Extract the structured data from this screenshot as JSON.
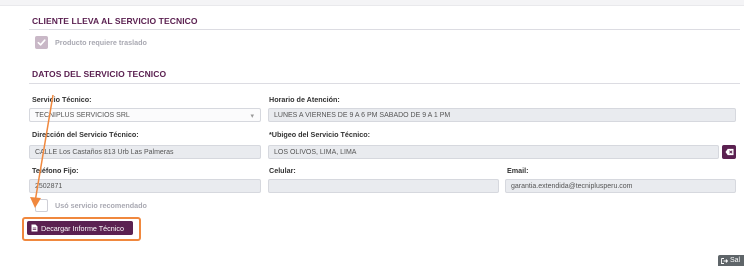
{
  "section_transport": {
    "title": "CLIENTE LLEVA AL SERVICIO TECNICO",
    "checkbox_label": "Producto requiere traslado",
    "checked": true
  },
  "section_service": {
    "title": "DATOS DEL SERVICIO TECNICO",
    "service_label": "Servicio Técnico:",
    "service_value": "TECNIPLUS SERVICIOS SRL",
    "schedule_label": "Horario de Atención:",
    "schedule_value": "LUNES A VIERNES DE  9 A 6 PM  SABADO DE 9 A 1 PM",
    "address_label": "Dirección del Servicio Técnico:",
    "address_value": "CALLE  Los Castaños 813  Urb Las Palmeras",
    "ubigeo_label": "*Ubigeo del Servicio Técnico:",
    "ubigeo_value": "LOS OLIVOS, LIMA, LIMA",
    "phone_label": "Teléfono Fijo:",
    "phone_value": "2502871",
    "cell_label": "Celular:",
    "cell_value": "",
    "email_label": "Email:",
    "email_value": "garantia.extendida@tecniplusperu.com",
    "recommended_label": "Usó servicio recomendado",
    "recommended_checked": false
  },
  "actions": {
    "download_label": "Decargar Informe Técnico",
    "exit_label": "Sal"
  },
  "colors": {
    "brand": "#5b2151",
    "highlight": "#f0883e"
  },
  "icons": {
    "checkbox": "check-icon",
    "download": "document-icon",
    "erase": "eraser-icon",
    "exit": "sign-out-icon",
    "select": "chevron-down-icon"
  }
}
